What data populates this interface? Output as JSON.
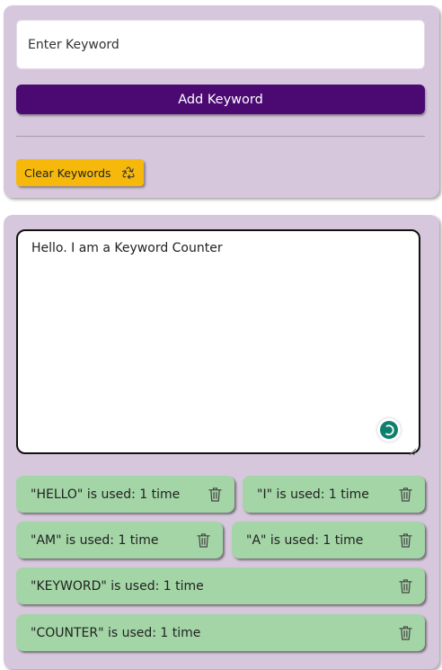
{
  "keyword_form": {
    "input_placeholder": "Enter Keyword",
    "input_value": "",
    "add_button_label": "Add Keyword",
    "clear_button_label": "Clear Keywords",
    "clear_icon": "recycle-icon"
  },
  "text_editor": {
    "content": "Hello. I am a Keyword Counter",
    "badge_icon": "grammar-check-icon"
  },
  "keyword_counts": [
    {
      "label": "\"HELLO\" is used: 1 time"
    },
    {
      "label": "\"I\" is used: 1 time"
    },
    {
      "label": "\"AM\" is used: 1 time"
    },
    {
      "label": "\"A\" is used: 1 time"
    },
    {
      "label": "\"KEYWORD\" is used: 1 time"
    },
    {
      "label": "\"COUNTER\" is used: 1 time"
    }
  ],
  "colors": {
    "panel_bg": "#d6c7dc",
    "add_button": "#4a0a72",
    "clear_button": "#f6b90b",
    "chip_bg": "#a3d5a6",
    "badge": "#0e7f6c"
  }
}
